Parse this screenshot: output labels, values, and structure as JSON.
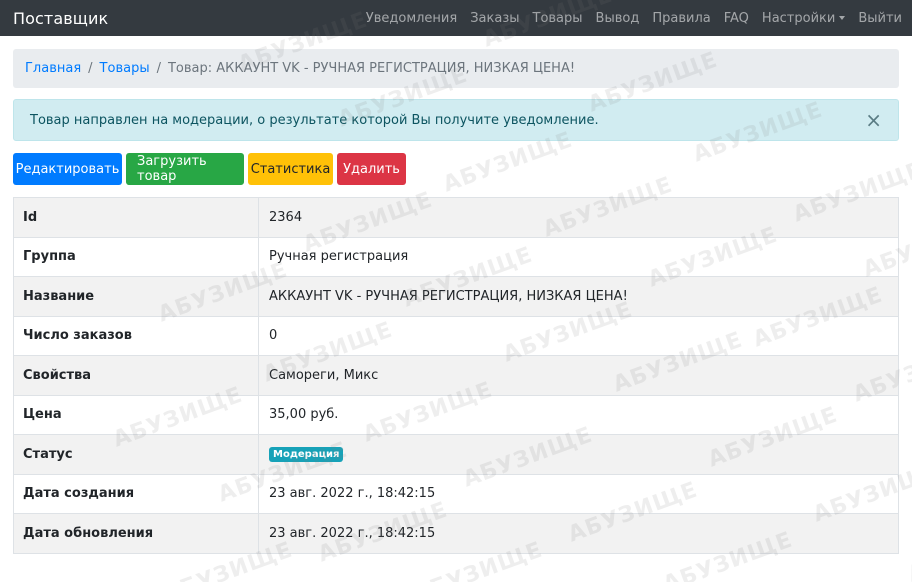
{
  "navbar": {
    "brand": "Поставщик",
    "links": [
      "Уведомления",
      "Заказы",
      "Товары",
      "Вывод",
      "Правила",
      "FAQ",
      "Настройки",
      "Выйти"
    ]
  },
  "breadcrumb": {
    "items": [
      "Главная",
      "Товары"
    ],
    "active": "Товар: АККАУНТ VK - РУЧНАЯ РЕГИСТРАЦИЯ, НИЗКАЯ ЦЕНА!"
  },
  "alert": {
    "message": "Товар направлен на модерации, о результате которой Вы получите уведомление.",
    "close": "×"
  },
  "buttons": {
    "edit": "Редактировать",
    "upload": "Загрузить товар",
    "stats": "Статистика",
    "delete": "Удалить"
  },
  "details": [
    {
      "label": "Id",
      "value": "2364"
    },
    {
      "label": "Группа",
      "value": "Ручная регистрация"
    },
    {
      "label": "Название",
      "value": "АККАУНТ VK - РУЧНАЯ РЕГИСТРАЦИЯ, НИЗКАЯ ЦЕНА!"
    },
    {
      "label": "Число заказов",
      "value": "0"
    },
    {
      "label": "Свойства",
      "value": "Самореги, Микс"
    },
    {
      "label": "Цена",
      "value": "35,00 руб."
    },
    {
      "label": "Статус",
      "value": "Модерация"
    },
    {
      "label": "Дата создания",
      "value": "23 авг. 2022 г., 18:42:15"
    },
    {
      "label": "Дата обновления",
      "value": "23 авг. 2022 г., 18:42:15"
    }
  ],
  "watermark": "АБУЗИЩЕ",
  "colors": {
    "navbar": "#343a40",
    "primary": "#007bff",
    "success": "#28a745",
    "warning": "#ffc107",
    "danger": "#dc3545",
    "info": "#17a2b8",
    "alert_bg": "#d1ecf1"
  }
}
